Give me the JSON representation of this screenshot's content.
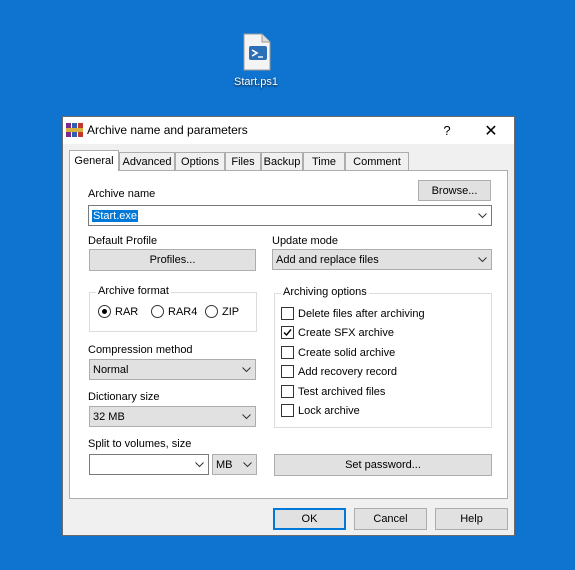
{
  "desktop": {
    "file_icon": "powershell-file-icon",
    "file_label": "Start.ps1",
    "background": "#0f74cf"
  },
  "dialog": {
    "title": "Archive name and parameters",
    "help_label": "?",
    "close_label": "✕",
    "tabs": [
      "General",
      "Advanced",
      "Options",
      "Files",
      "Backup",
      "Time",
      "Comment"
    ],
    "active_tab": "General",
    "archive_name_label": "Archive name",
    "browse_label": "Browse...",
    "archive_name_value": "Start.exe",
    "default_profile_label": "Default Profile",
    "profiles_label": "Profiles...",
    "update_mode_label": "Update mode",
    "update_mode_value": "Add and replace files",
    "archive_format_label": "Archive format",
    "formats": [
      {
        "label": "RAR",
        "selected": true
      },
      {
        "label": "RAR4",
        "selected": false
      },
      {
        "label": "ZIP",
        "selected": false
      }
    ],
    "archiving_options_label": "Archiving options",
    "options": [
      {
        "label": "Delete files after archiving",
        "checked": false
      },
      {
        "label": "Create SFX archive",
        "checked": true
      },
      {
        "label": "Create solid archive",
        "checked": false
      },
      {
        "label": "Add recovery record",
        "checked": false
      },
      {
        "label": "Test archived files",
        "checked": false
      },
      {
        "label": "Lock archive",
        "checked": false
      }
    ],
    "compression_label": "Compression method",
    "compression_value": "Normal",
    "dictionary_label": "Dictionary size",
    "dictionary_value": "32 MB",
    "split_label": "Split to volumes, size",
    "split_value": "",
    "split_unit": "MB",
    "set_password_label": "Set password...",
    "ok_label": "OK",
    "cancel_label": "Cancel",
    "help_button_label": "Help",
    "accent": "#0078d7"
  }
}
